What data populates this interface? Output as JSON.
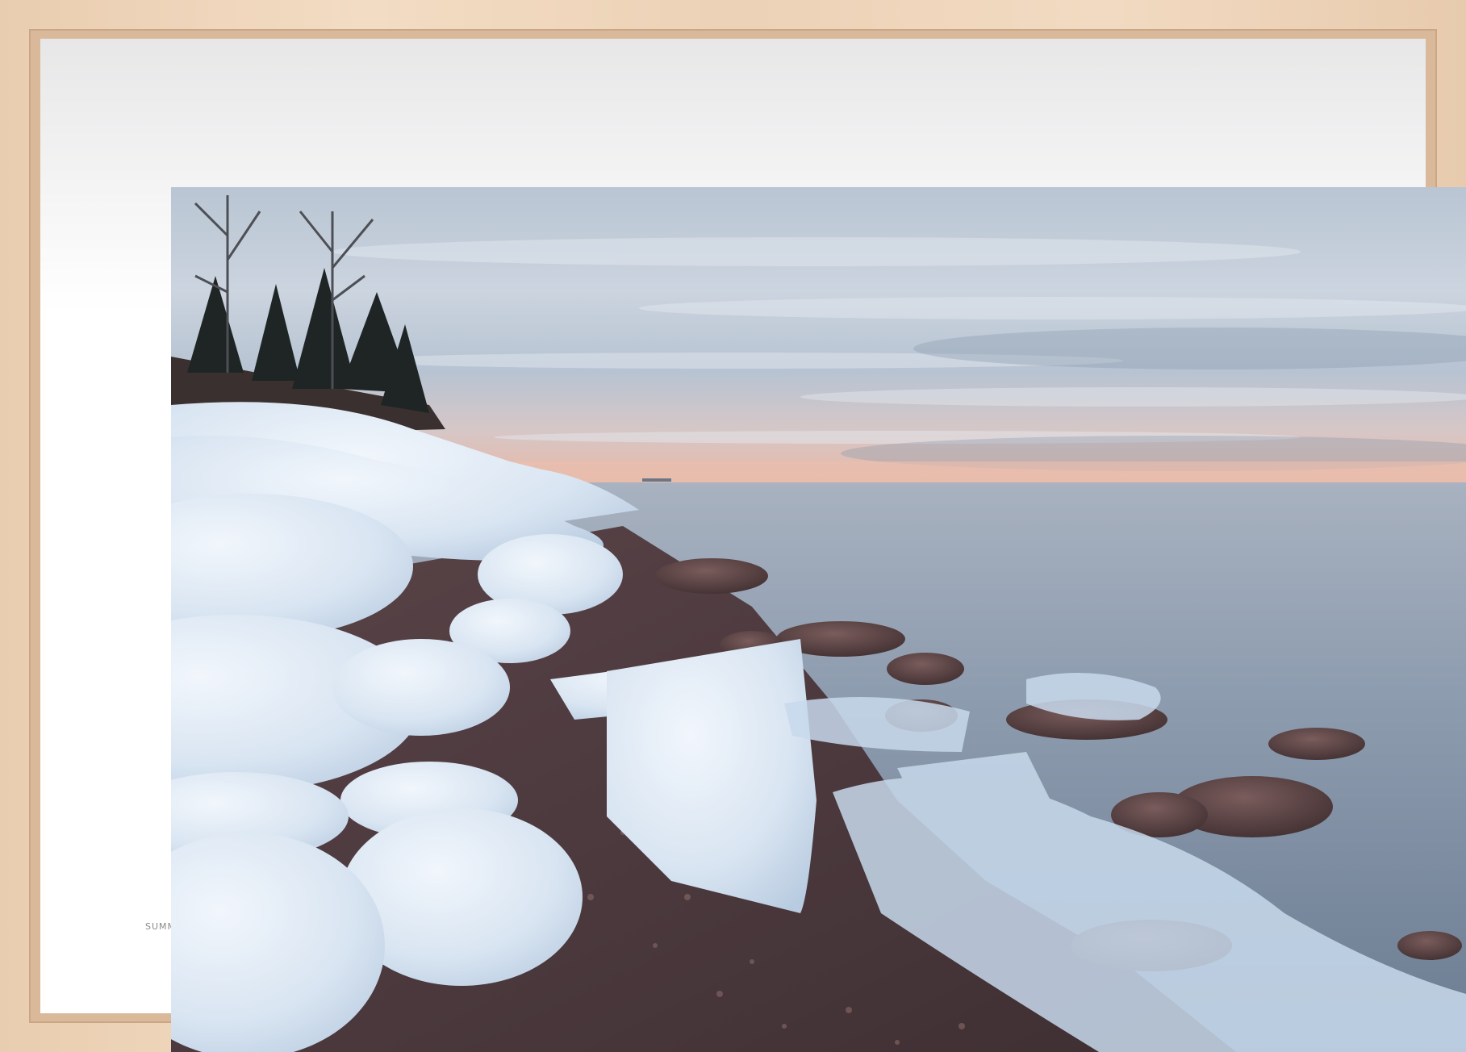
{
  "mat": {
    "caption": "SUMM"
  },
  "colors": {
    "frame_wood": "#ecd2b6",
    "mat": "#ffffff",
    "sky_top": "#c9d2dd",
    "horizon_glow": "#e7b9a6",
    "water": "#8c9cb0",
    "ice": "#e6eef8",
    "pebbles": "#4e3a3a"
  }
}
